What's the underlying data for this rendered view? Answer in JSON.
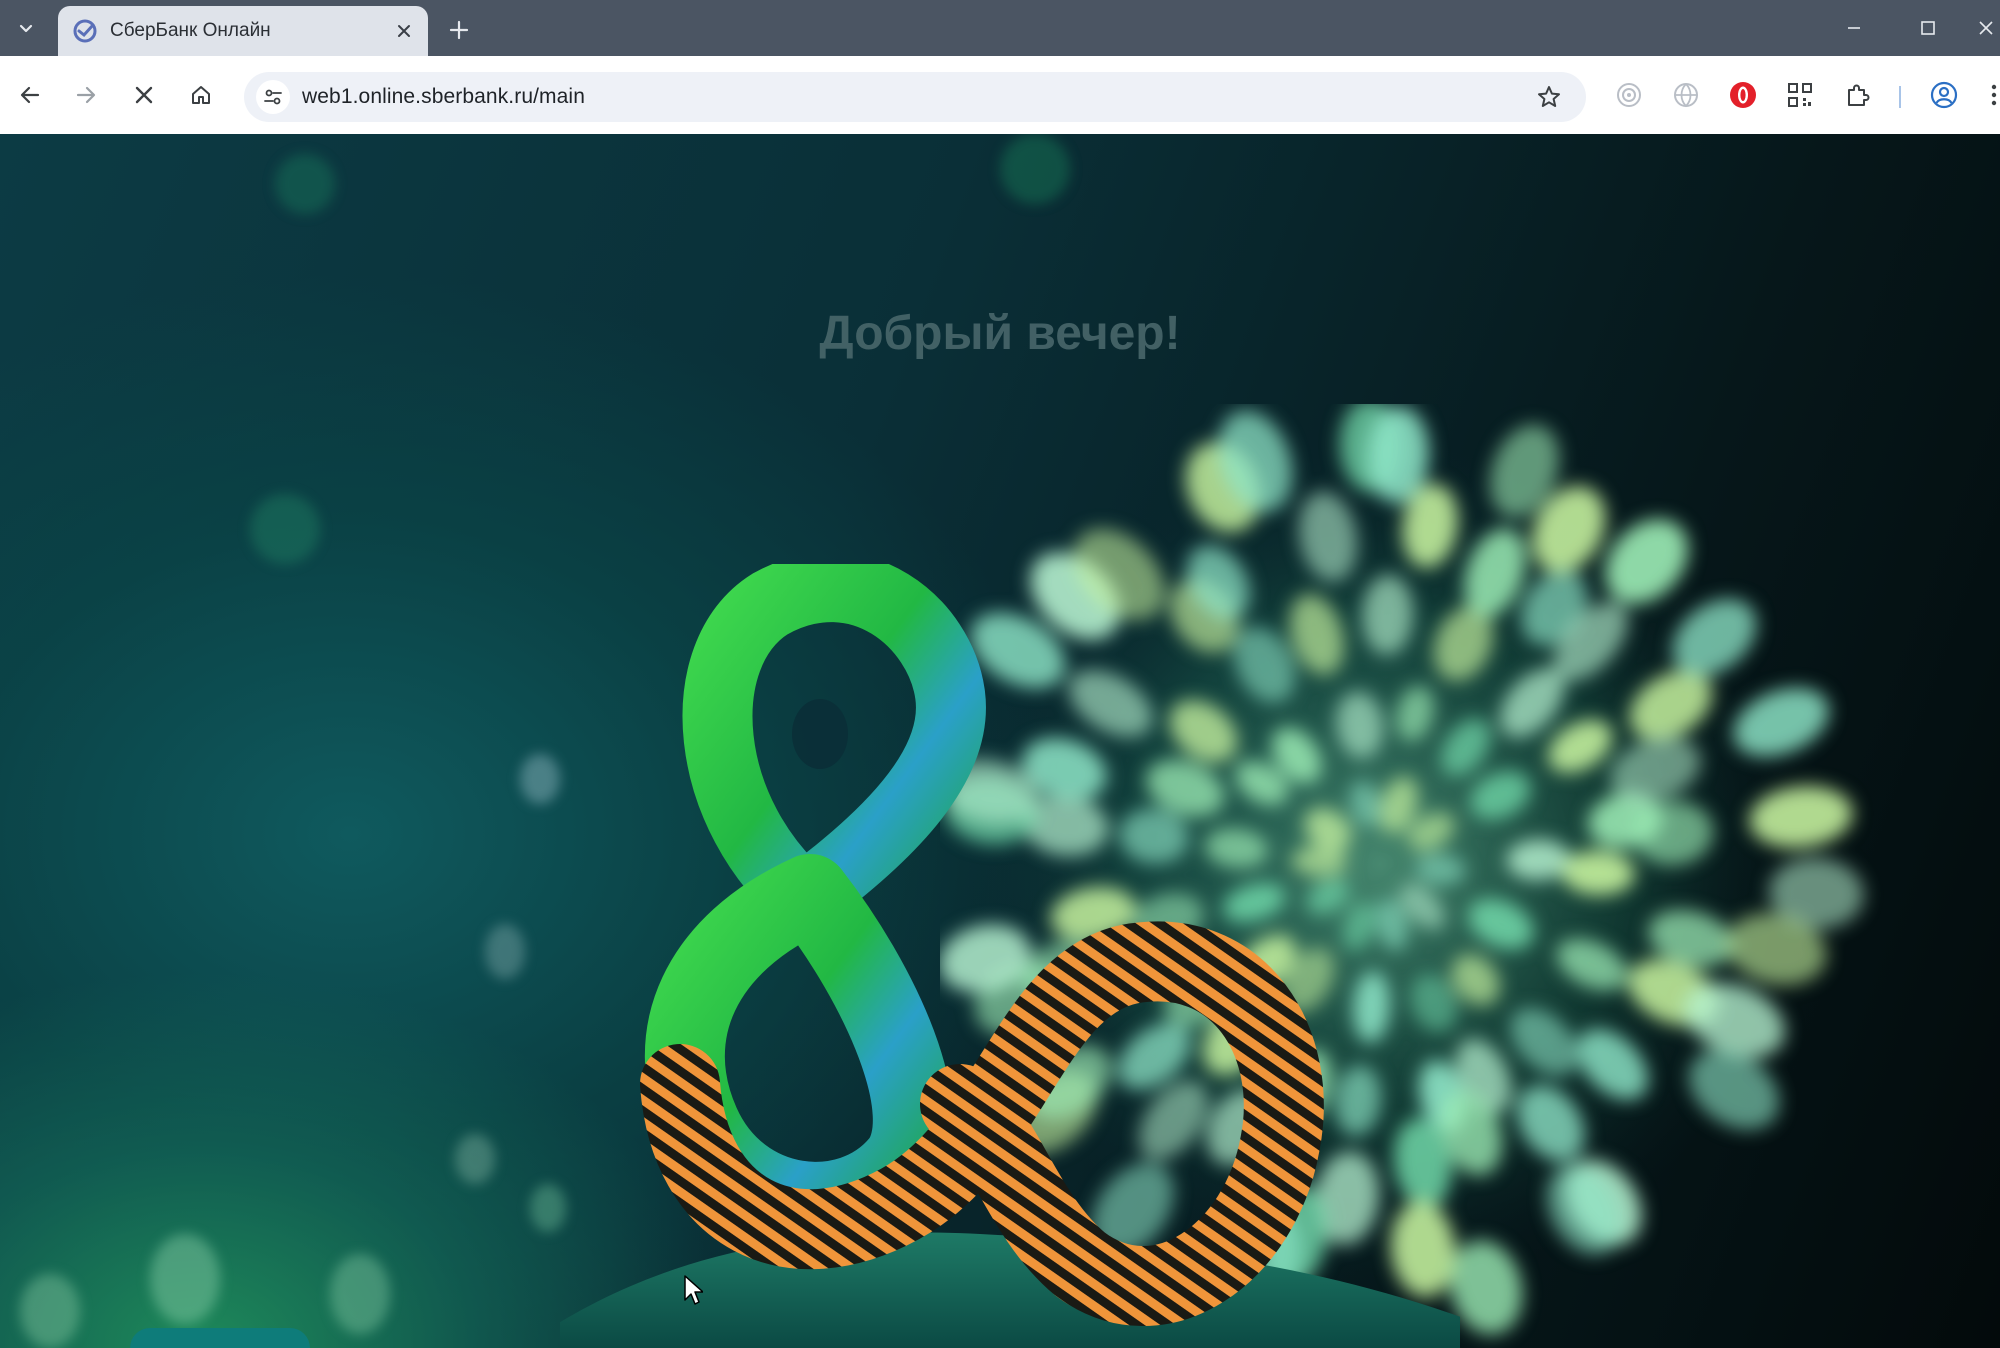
{
  "browser": {
    "tab": {
      "title": "СберБанк Онлайн",
      "favicon": "sberbank-logo-icon"
    },
    "url": "web1.online.sberbank.ru/main",
    "loading": true,
    "accent": "#2b6fc4"
  },
  "page": {
    "greeting": "Добрый вечер!",
    "brand_colors": {
      "green": "#2bd24a",
      "teal": "#0c3b44",
      "ribbon_orange": "#f0953a",
      "ribbon_black": "#1a1a14"
    }
  }
}
